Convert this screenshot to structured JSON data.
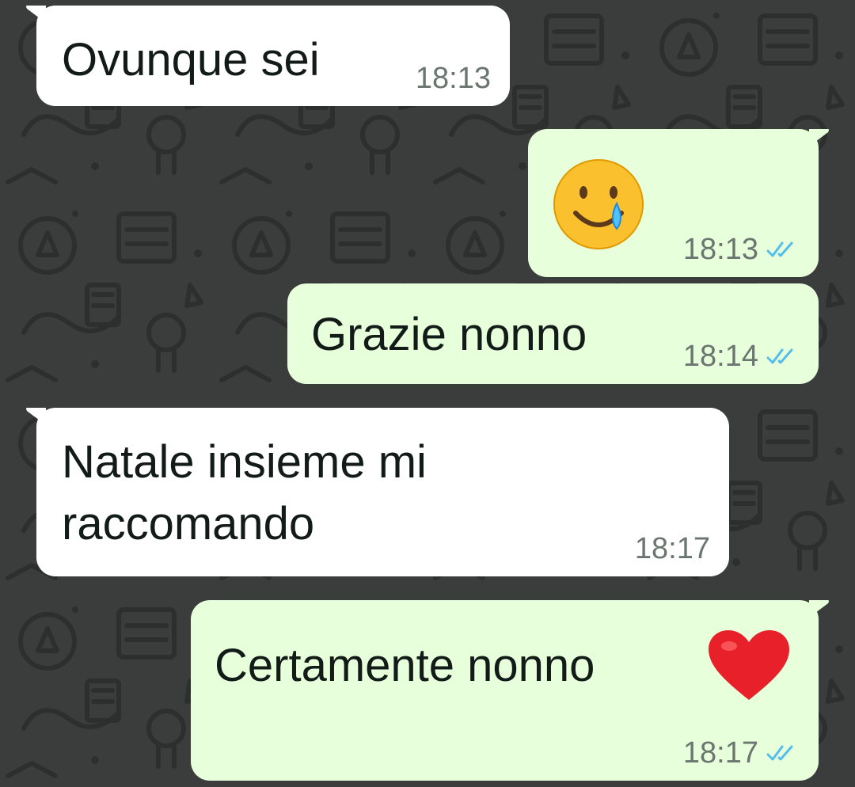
{
  "colors": {
    "wallpaper": "#3a3d3c",
    "incoming_bubble": "#ffffff",
    "outgoing_bubble": "#e7ffdb",
    "read_ticks": "#53bdeb",
    "timestamp": "#6b7670"
  },
  "messages": [
    {
      "direction": "incoming",
      "text": "Ovunque sei",
      "time": "18:13"
    },
    {
      "direction": "outgoing",
      "emoji": "🥲",
      "emoji_name": "smiling-face-with-tear-icon",
      "time": "18:13",
      "status": "read"
    },
    {
      "direction": "outgoing",
      "text": "Grazie nonno",
      "time": "18:14",
      "status": "read"
    },
    {
      "direction": "incoming",
      "text_line1": "Natale insieme mi",
      "text_line2": "raccomando",
      "time": "18:17"
    },
    {
      "direction": "outgoing",
      "text": "Certamente nonno",
      "emoji": "❤️",
      "emoji_name": "red-heart-icon",
      "time": "18:17",
      "status": "read"
    }
  ]
}
